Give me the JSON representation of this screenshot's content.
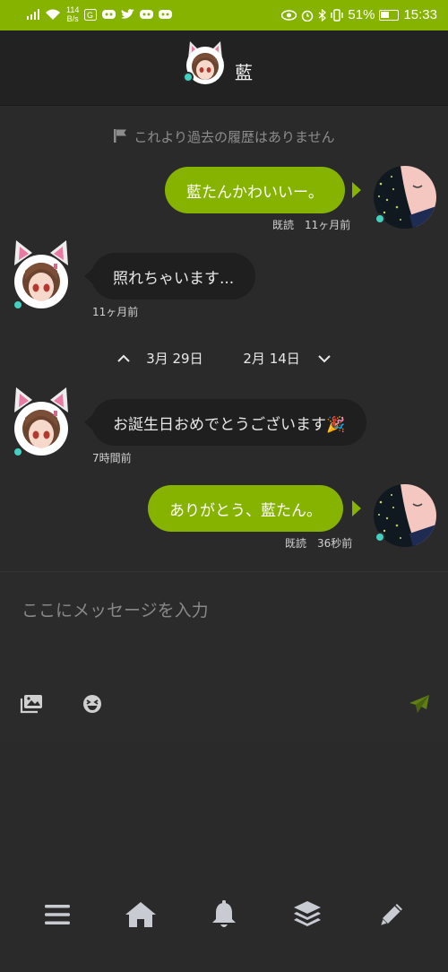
{
  "status_bar": {
    "net_speed_value": "114",
    "net_speed_unit": "B/s",
    "battery": "51%",
    "time": "15:33"
  },
  "header": {
    "name": "藍"
  },
  "chat": {
    "history_notice": "これより過去の履歴はありません",
    "messages": [
      {
        "from": "me",
        "text": "藍たんかわいいー。",
        "meta": "既読　11ヶ月前"
      },
      {
        "from": "them",
        "text": "照れちゃいます...",
        "meta": "11ヶ月前"
      },
      {
        "from": "them",
        "text": "お誕生日おめでとうございます🎉",
        "meta": "7時間前"
      },
      {
        "from": "me",
        "text": "ありがとう、藍たん。",
        "meta": "既読　36秒前"
      }
    ],
    "date_nav": {
      "prev": "3月 29日",
      "next": "2月 14日"
    }
  },
  "composer": {
    "placeholder": "ここにメッセージを入力"
  },
  "colors": {
    "accent": "#86b300",
    "online": "#42d1c0",
    "background": "#2a2a2a"
  }
}
